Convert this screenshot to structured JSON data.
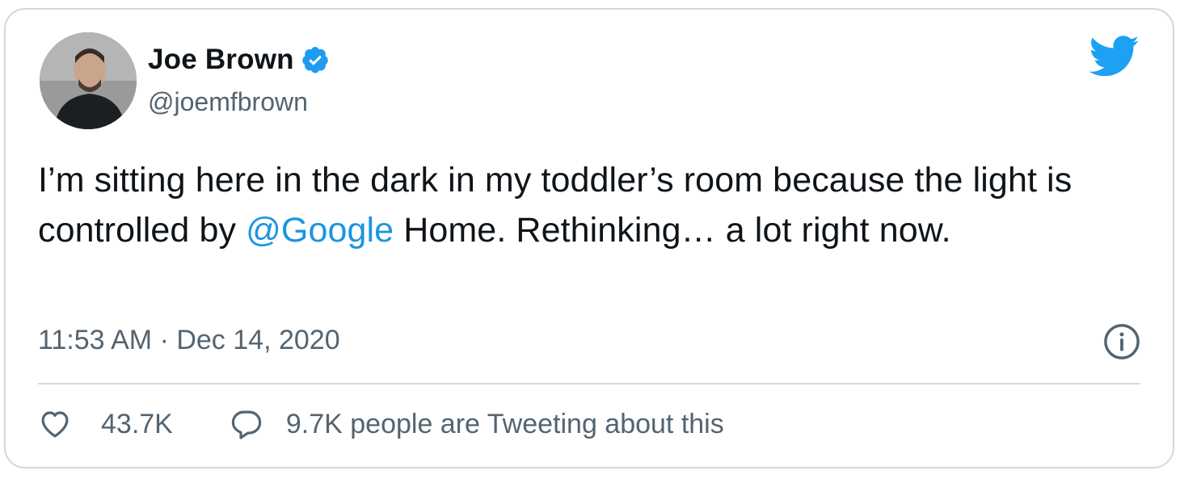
{
  "tweet": {
    "author": {
      "name": "Joe Brown",
      "handle": "@joemfbrown",
      "verified": true,
      "avatar_icon": "profile-photo"
    },
    "text_before": "I’m sitting here in the dark in my toddler’s room because the light is controlled by ",
    "mention": "@Google",
    "text_after": " Home. Rethinking… a lot right now.",
    "timestamp": "11:53 AM · Dec 14, 2020",
    "likes": "43.7K",
    "conversation": "9.7K people are Tweeting about this"
  },
  "icons": {
    "brand": "twitter-bird-icon",
    "verified": "verified-badge-icon",
    "info": "info-icon",
    "like": "heart-icon",
    "reply": "speech-bubble-icon"
  },
  "colors": {
    "accent": "#1da1f2",
    "mention": "#1b95e0",
    "text": "#0f1419",
    "secondary": "#536471",
    "border": "#cfd9de"
  }
}
